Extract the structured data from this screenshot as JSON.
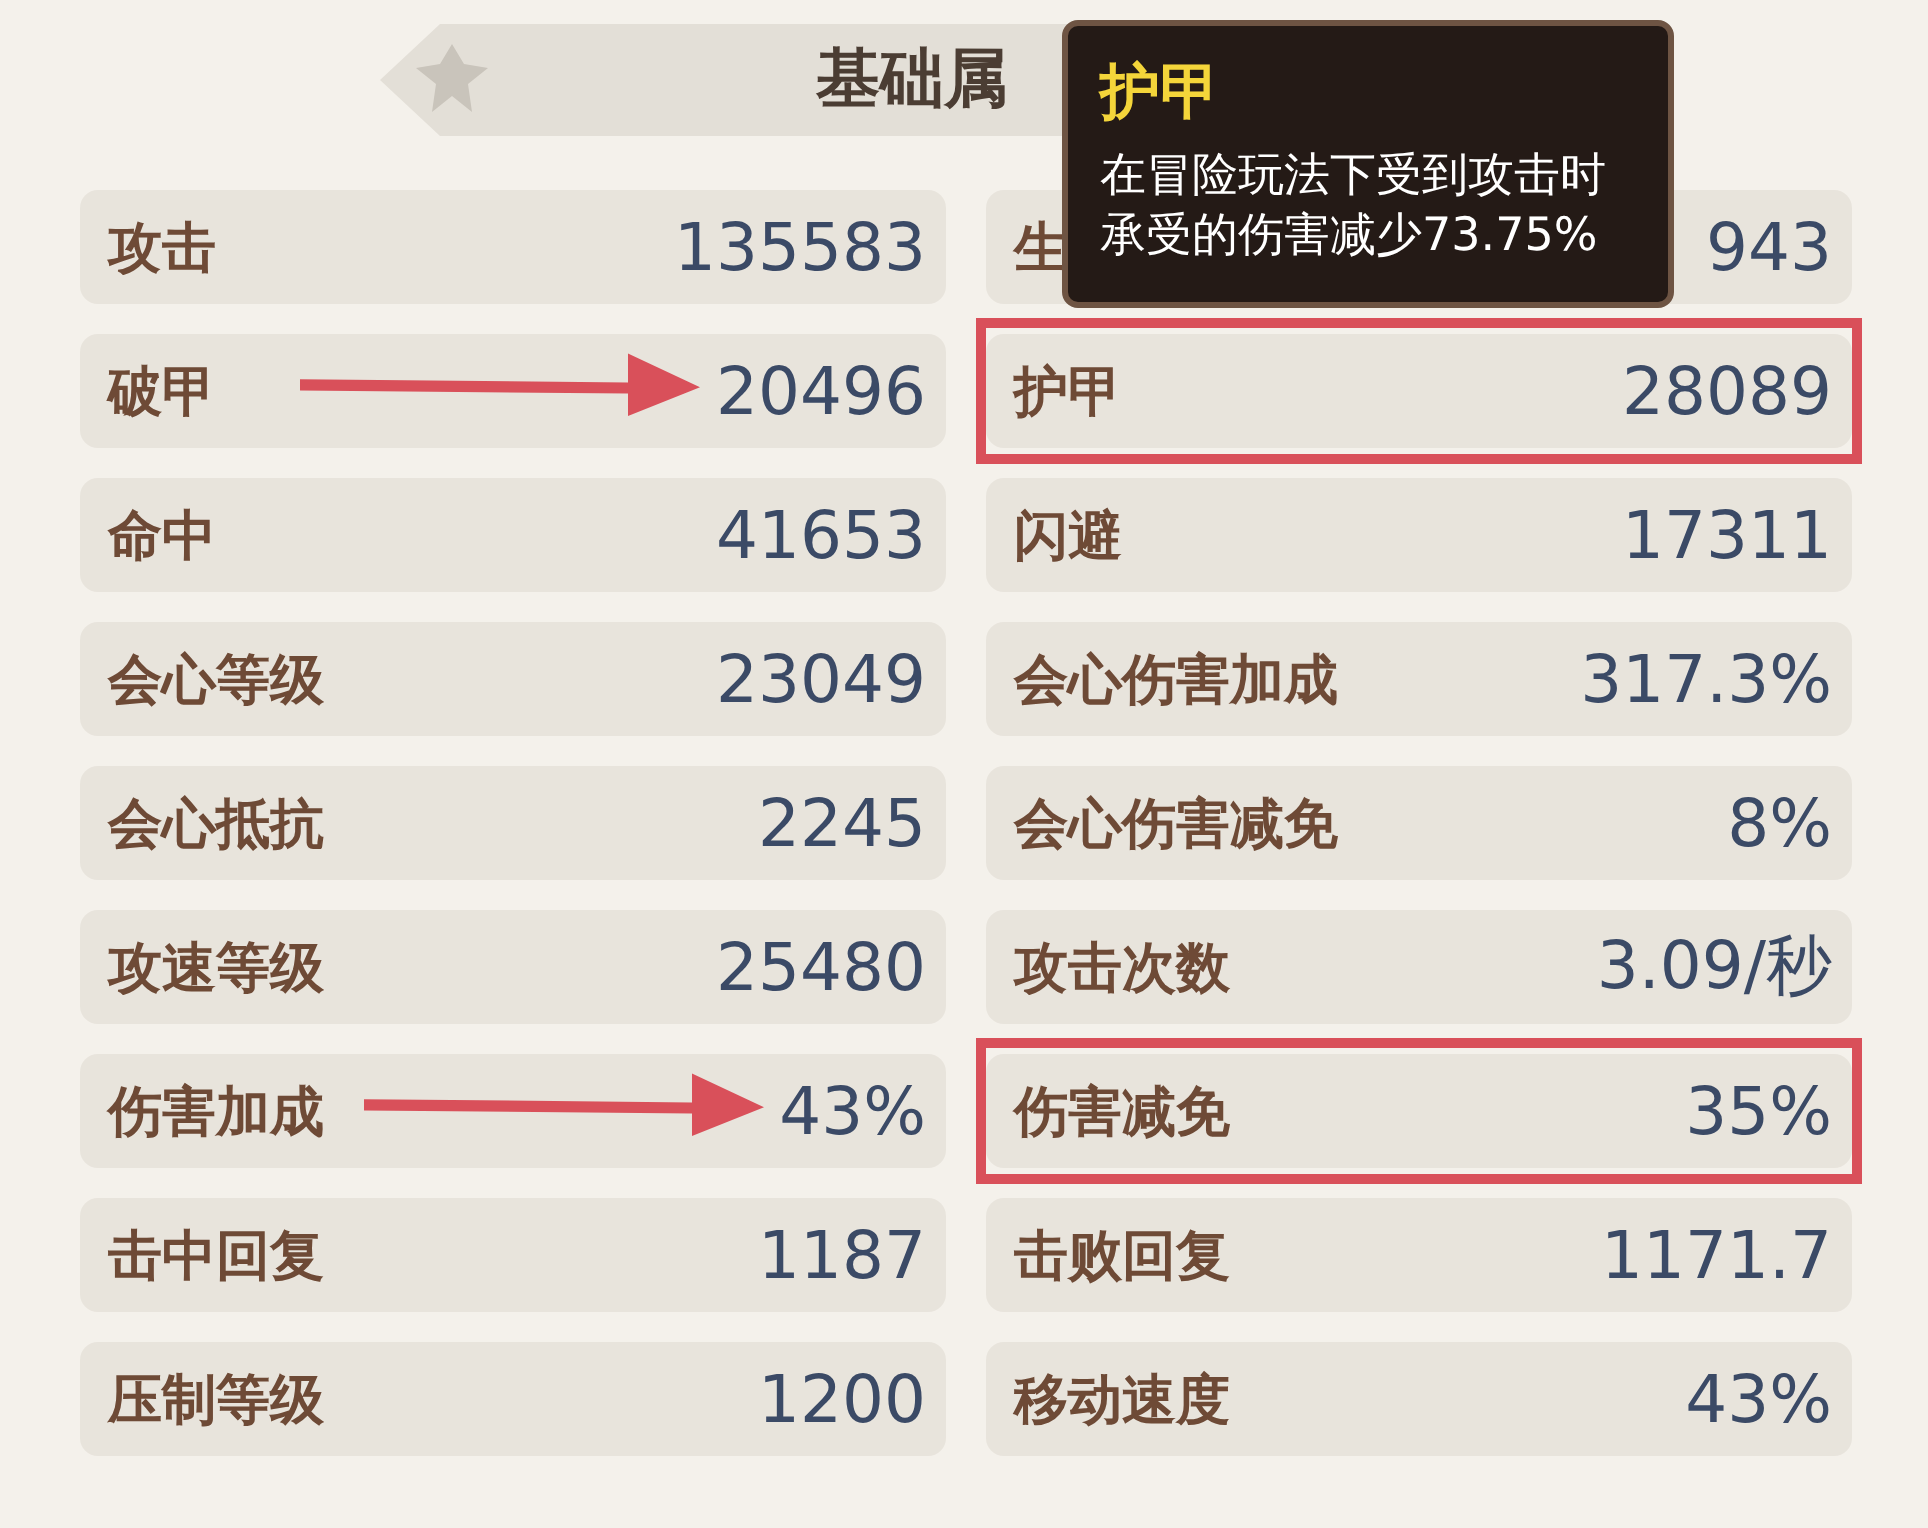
{
  "header": {
    "title": "基础属"
  },
  "tooltip": {
    "title": "护甲",
    "lines": [
      "在冒险玩法下受到攻击时",
      "承受的伤害减少73.75%"
    ]
  },
  "left_stats": [
    {
      "label": "攻击",
      "value": "135583",
      "arrow": false
    },
    {
      "label": "破甲",
      "value": "20496",
      "arrow": true
    },
    {
      "label": "命中",
      "value": "41653",
      "arrow": false
    },
    {
      "label": "会心等级",
      "value": "23049",
      "arrow": false
    },
    {
      "label": "会心抵抗",
      "value": "2245",
      "arrow": false
    },
    {
      "label": "攻速等级",
      "value": "25480",
      "arrow": false
    },
    {
      "label": "伤害加成",
      "value": "43%",
      "arrow": true
    },
    {
      "label": "击中回复",
      "value": "1187",
      "arrow": false
    },
    {
      "label": "压制等级",
      "value": "1200",
      "arrow": false
    }
  ],
  "right_stats": [
    {
      "label": "生",
      "value": "943",
      "highlighted": false
    },
    {
      "label": "护甲",
      "value": "28089",
      "highlighted": true
    },
    {
      "label": "闪避",
      "value": "17311",
      "highlighted": false
    },
    {
      "label": "会心伤害加成",
      "value": "317.3%",
      "highlighted": false
    },
    {
      "label": "会心伤害减免",
      "value": "8%",
      "highlighted": false
    },
    {
      "label": "攻击次数",
      "value": "3.09/秒",
      "highlighted": false
    },
    {
      "label": "伤害减免",
      "value": "35%",
      "highlighted": true
    },
    {
      "label": "击败回复",
      "value": "1171.7",
      "highlighted": false
    },
    {
      "label": "移动速度",
      "value": "43%",
      "highlighted": false
    }
  ]
}
